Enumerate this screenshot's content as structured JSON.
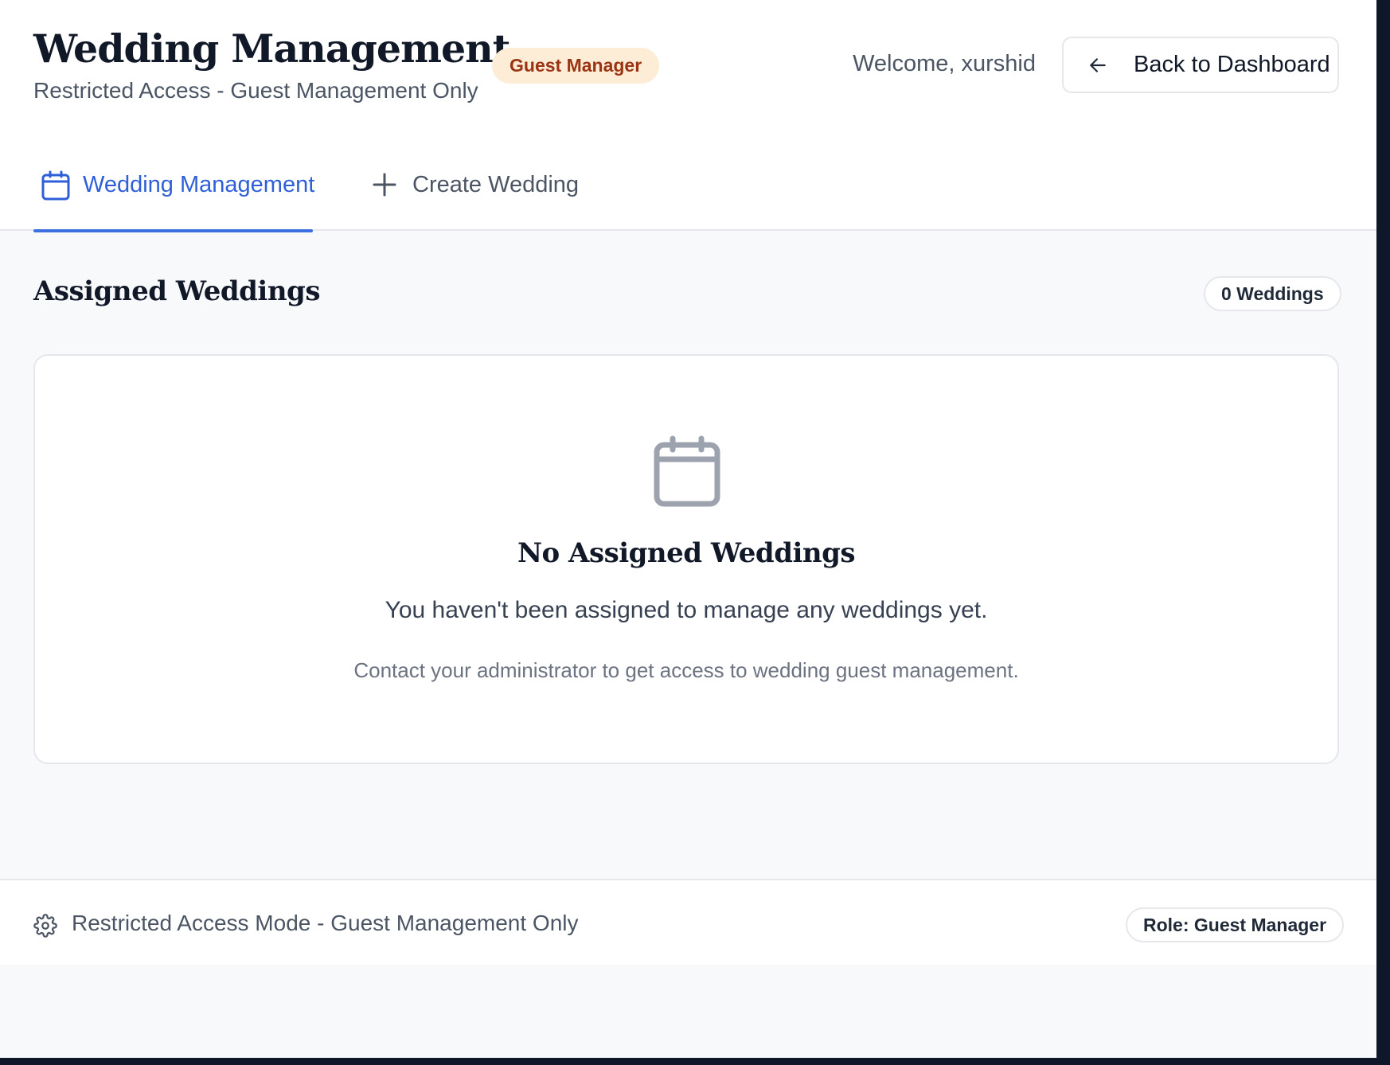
{
  "header": {
    "title": "Wedding Management",
    "subtitle": "Restricted Access - Guest Management Only",
    "role_badge": "Guest Manager",
    "welcome": "Welcome, xurshid",
    "back_button": {
      "label": "Back to Dashboard",
      "icon": "arrow-left-icon"
    }
  },
  "tabs": [
    {
      "label": "Wedding Management",
      "icon": "calendar-icon",
      "active": true
    },
    {
      "label": "Create Wedding",
      "icon": "plus-icon",
      "active": false
    }
  ],
  "main": {
    "section_title": "Assigned Weddings",
    "count_badge": "0 Weddings",
    "empty_state": {
      "icon": "calendar-icon",
      "title": "No Assigned Weddings",
      "message": "You haven't been assigned to manage any weddings yet.",
      "help": "Contact your administrator to get access to wedding guest management."
    }
  },
  "footer": {
    "icon": "gear-icon",
    "mode_text": "Restricted Access Mode - Guest Management Only",
    "role_pill": "Role: Guest Manager"
  },
  "colors": {
    "accent": "#3b6fe0",
    "badge_bg": "#fdecd6",
    "badge_text": "#9a3412",
    "page_bg": "#f8f9fb"
  }
}
